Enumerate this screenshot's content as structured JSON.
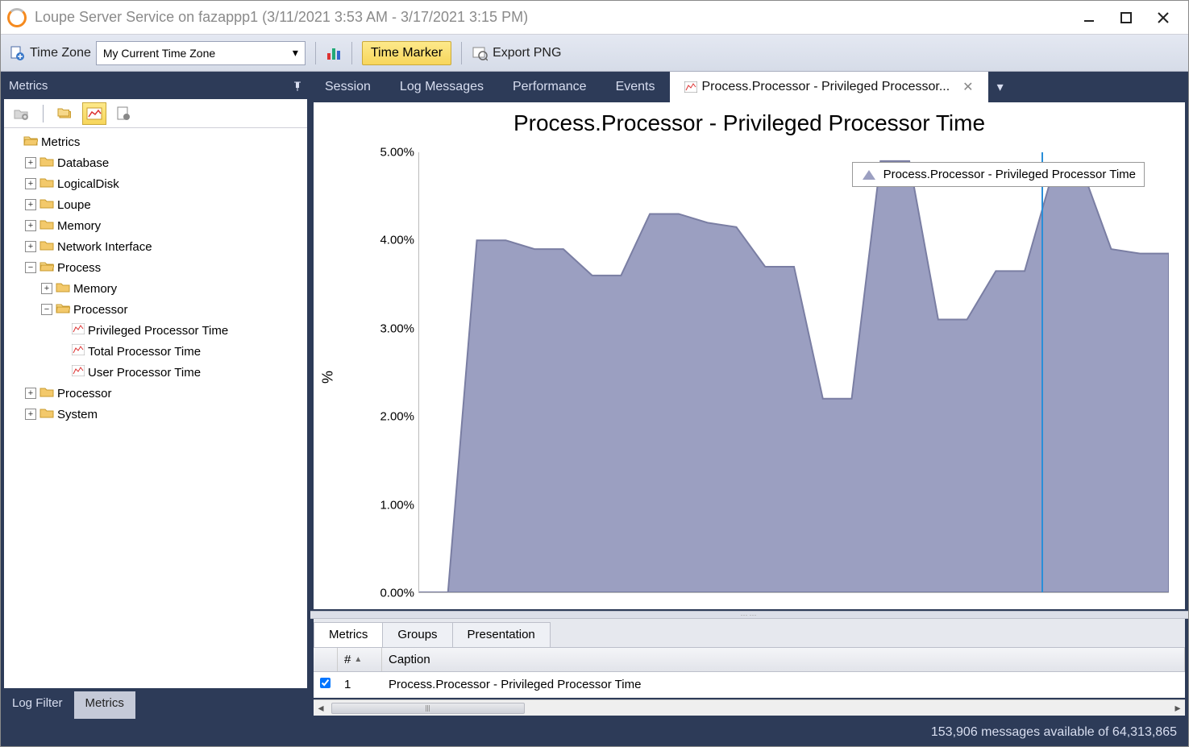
{
  "window": {
    "title": "Loupe Server Service on fazappp1 (3/11/2021 3:53 AM - 3/17/2021 3:15 PM)"
  },
  "toolbar": {
    "time_zone_label": "Time Zone",
    "time_zone_value": "My Current Time Zone",
    "time_marker_label": "Time Marker",
    "export_label": "Export PNG"
  },
  "sidebar": {
    "panel_title": "Metrics",
    "tabs": {
      "log_filter": "Log Filter",
      "metrics": "Metrics"
    },
    "tree": {
      "root": "Metrics",
      "top": [
        "Database",
        "LogicalDisk",
        "Loupe",
        "Memory",
        "Network Interface"
      ],
      "process": {
        "label": "Process",
        "memory": "Memory",
        "processor": {
          "label": "Processor",
          "items": [
            "Privileged Processor Time",
            "Total Processor Time",
            "User Processor Time"
          ]
        }
      },
      "tail": [
        "Processor",
        "System"
      ]
    }
  },
  "doc_tabs": {
    "session": "Session",
    "log_messages": "Log Messages",
    "performance": "Performance",
    "events": "Events",
    "active": "Process.Processor - Privileged Processor..."
  },
  "chart": {
    "title": "Process.Processor - Privileged Processor Time",
    "ylabel": "%",
    "legend": "Process.Processor - Privileged Processor Time",
    "yticks": [
      "0.00%",
      "1.00%",
      "2.00%",
      "3.00%",
      "4.00%",
      "5.00%"
    ]
  },
  "detail": {
    "tabs": {
      "metrics": "Metrics",
      "groups": "Groups",
      "presentation": "Presentation"
    },
    "columns": {
      "num": "#",
      "caption": "Caption"
    },
    "row": {
      "num": "1",
      "caption": "Process.Processor - Privileged Processor Time"
    }
  },
  "status": "153,906 messages available of 64,313,865",
  "chart_data": {
    "type": "area",
    "title": "Process.Processor - Privileged Processor Time",
    "ylabel": "%",
    "ylim": [
      0,
      5
    ],
    "series": [
      {
        "name": "Process.Processor - Privileged Processor Time",
        "values": [
          0.0,
          0.0,
          4.0,
          4.0,
          3.9,
          3.9,
          3.6,
          3.6,
          4.3,
          4.3,
          4.2,
          4.15,
          3.7,
          3.7,
          2.2,
          2.2,
          4.9,
          4.9,
          3.1,
          3.1,
          3.65,
          3.65,
          4.8,
          4.8,
          3.9,
          3.85,
          3.85
        ]
      }
    ],
    "legend_position": "top-right",
    "time_marker_fraction": 0.83
  }
}
